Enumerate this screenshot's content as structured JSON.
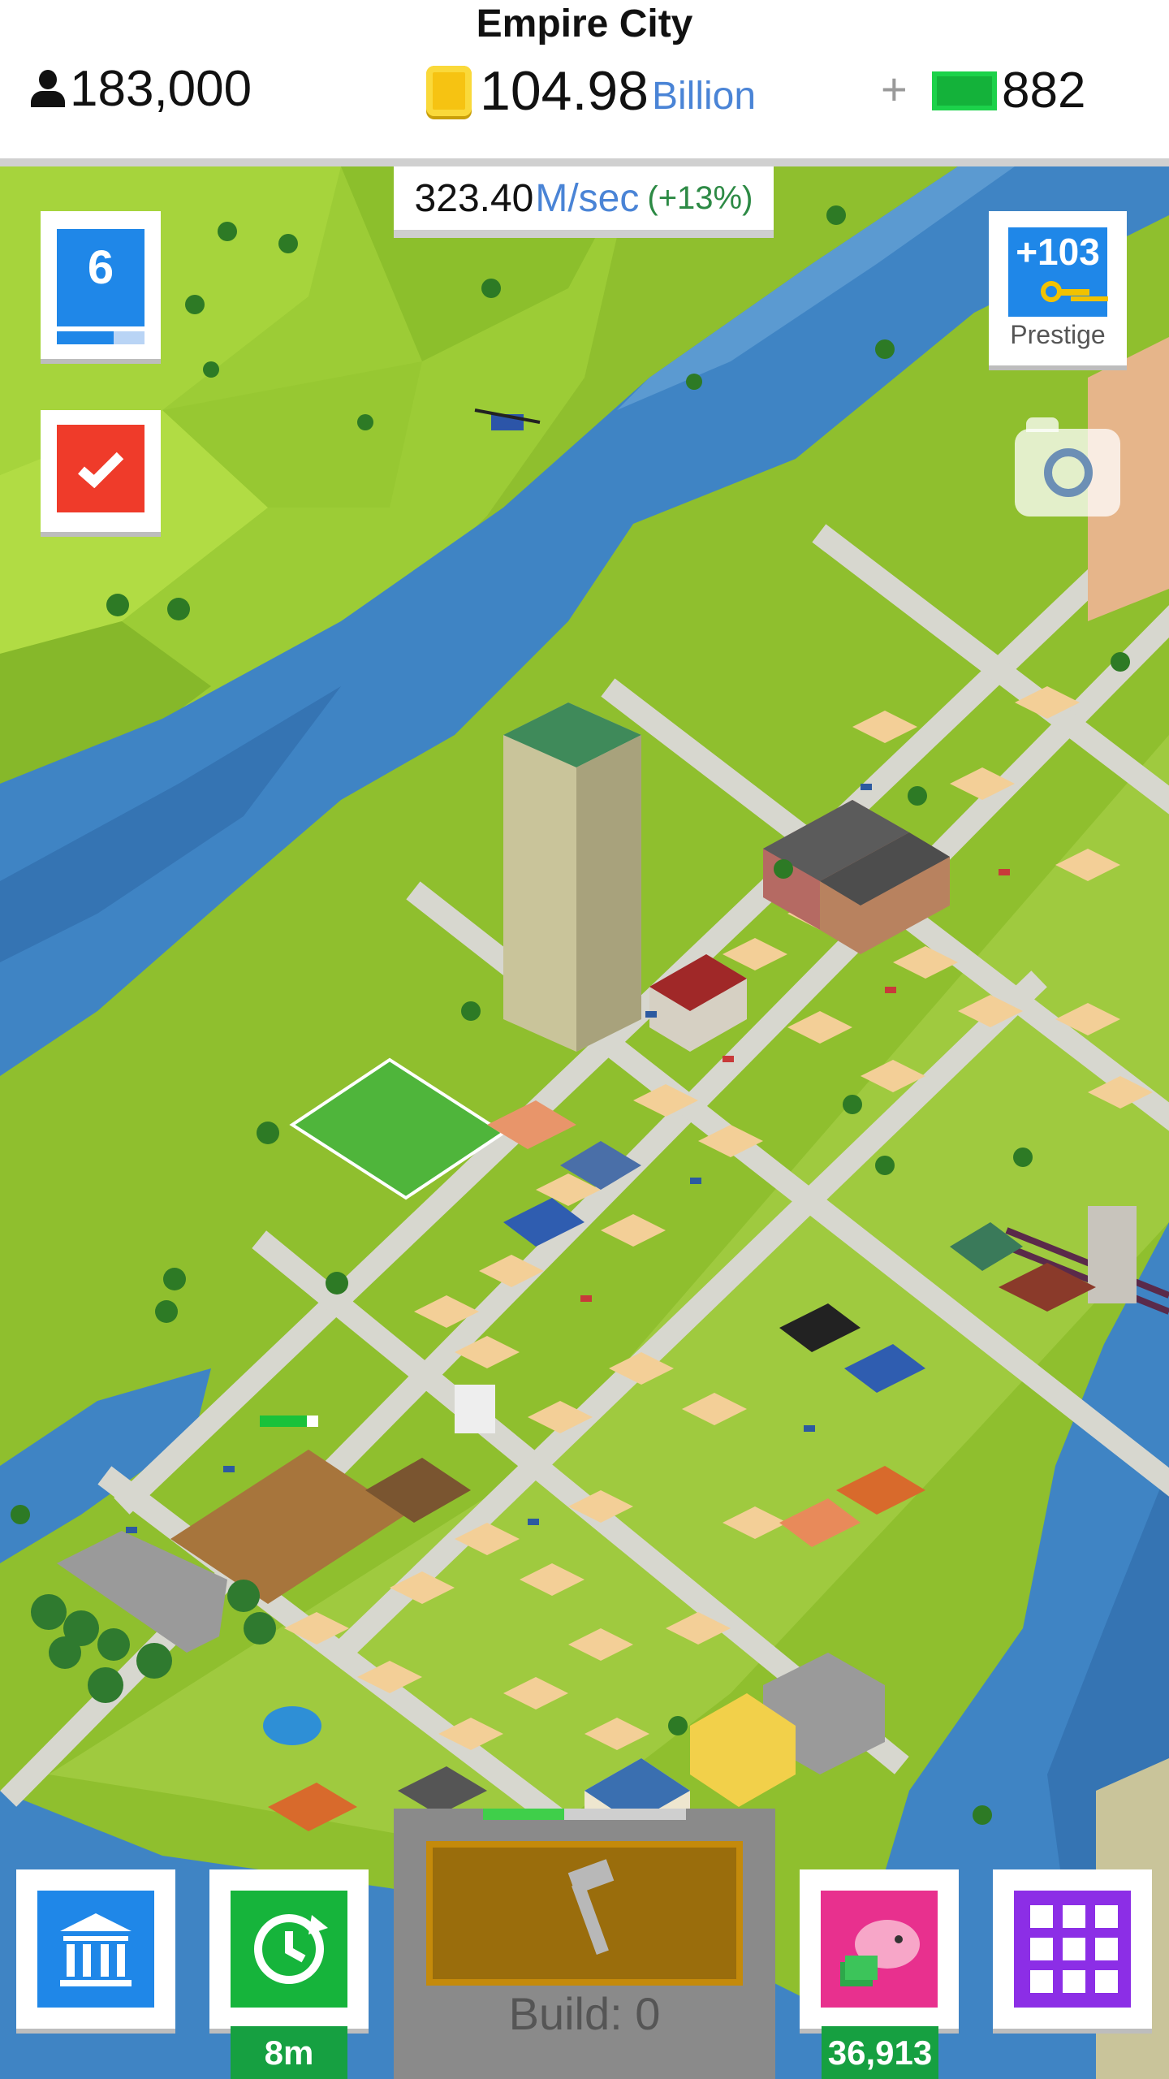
{
  "header": {
    "city_name": "Empire City",
    "population": "183,000",
    "coins_amount": "104.98",
    "coins_unit": "Billion",
    "plus_symbol": "+",
    "cash": "882"
  },
  "income": {
    "amount": "323.40",
    "unit": "M/sec",
    "percent": "(+13%)"
  },
  "level": {
    "number": "6",
    "progress_fraction": 0.65
  },
  "prestige": {
    "value": "+103",
    "label": "Prestige"
  },
  "map": {
    "construction_progress_fraction": 0.8
  },
  "bottom": {
    "speed_badge": "8m",
    "piggy_badge": "36,913",
    "build_label": "Build: 0",
    "build_progress_fraction": 0.4
  },
  "colors": {
    "accent_blue": "#1f87e8",
    "task_red": "#ef3b2a",
    "speed_green": "#16b43b",
    "piggy_pink": "#e8308e",
    "menu_purple": "#8c2ee6",
    "river_blue": "#3f84c4",
    "grass_green": "#8fbf2e"
  },
  "icons": {
    "population": "person-icon",
    "coins": "coin-icon",
    "cash": "cash-icon",
    "prestige": "key-icon",
    "task": "check-icon",
    "camera": "camera-icon",
    "bank": "bank-icon",
    "speed": "clock-refresh-icon",
    "piggy": "piggy-bank-icon",
    "menu": "grid-icon",
    "build": "hammer-hand-icon"
  }
}
